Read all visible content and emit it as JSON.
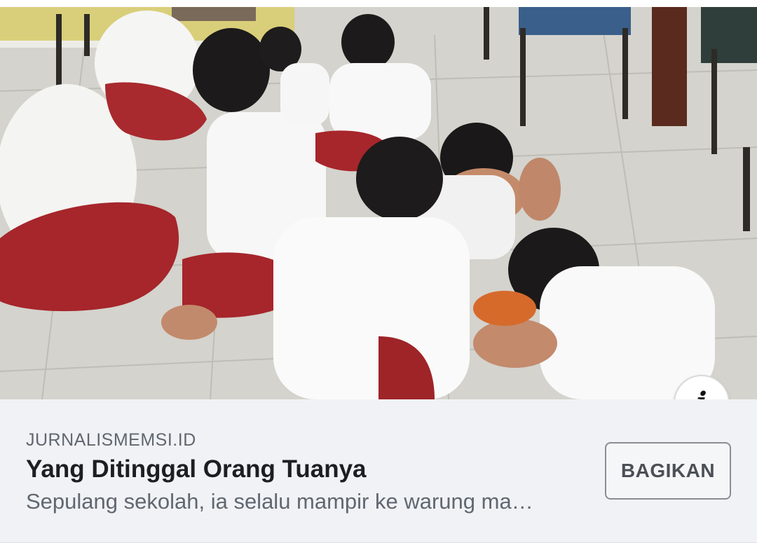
{
  "link_preview": {
    "image_alt": "Photo of schoolchildren in white and red uniforms sitting on a tiled classroom floor",
    "info_icon": "info-icon",
    "domain": "JURNALISMEMSI.ID",
    "title": "Yang Ditinggal Orang Tuanya",
    "description": "Sepulang sekolah, ia selalu mampir ke warung ma…",
    "share_label": "BAGIKAN"
  }
}
